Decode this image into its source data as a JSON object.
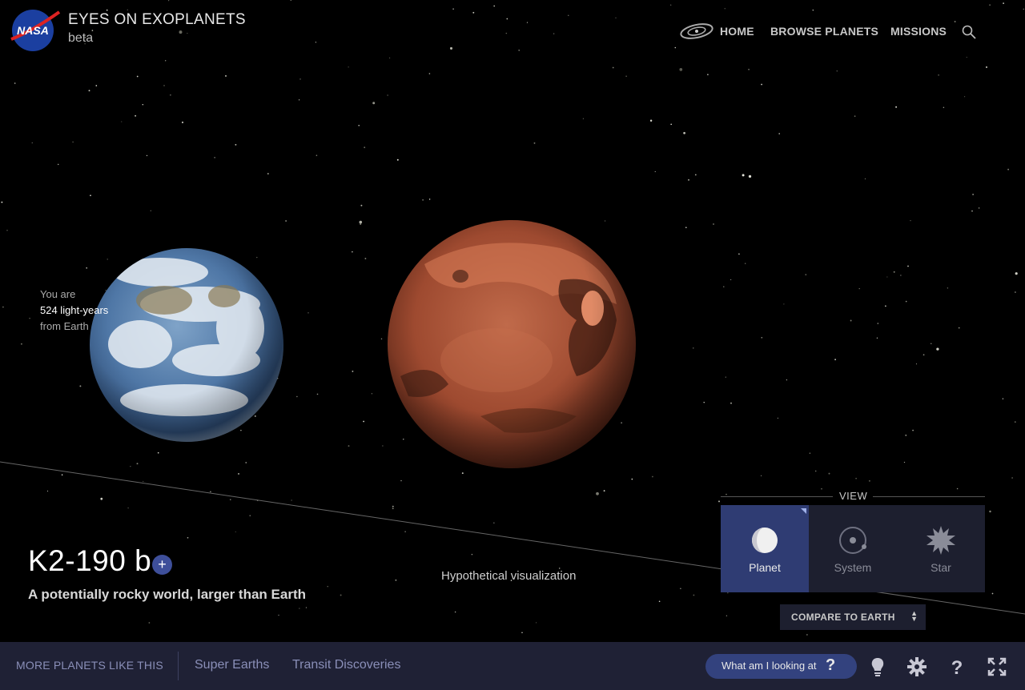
{
  "header": {
    "logo": "nasa-logo",
    "logo_text": "NASA",
    "title": "EYES ON EXOPLANETS",
    "subtitle": "beta",
    "nav": [
      "HOME",
      "BROWSE PLANETS",
      "MISSIONS"
    ],
    "nav_icons": [
      "galaxy-icon",
      "search-icon"
    ]
  },
  "distance": {
    "line1": "You are",
    "value": "524 light-years",
    "line3": "from Earth"
  },
  "planet": {
    "name": "K2-190 b",
    "tagline": "A potentially rocky world, larger than Earth",
    "visualization_note": "Hypothetical visualization"
  },
  "view": {
    "label": "VIEW",
    "options": [
      {
        "label": "Planet",
        "icon": "planet-icon",
        "active": true
      },
      {
        "label": "System",
        "icon": "system-icon",
        "active": false
      },
      {
        "label": "Star",
        "icon": "star-icon",
        "active": false
      }
    ]
  },
  "compare": {
    "label": "COMPARE TO EARTH"
  },
  "bottom_bar": {
    "more_label": "MORE PLANETS LIKE THIS",
    "tags": [
      "Super Earths",
      "Transit Discoveries"
    ],
    "help_button": "What am I looking at",
    "help_glyph": "?",
    "icons": [
      "lightbulb-icon",
      "gear-icon",
      "help-icon",
      "fullscreen-icon"
    ]
  },
  "colors": {
    "background": "#000000",
    "bar": "#1f2135",
    "accent": "#33427e",
    "panel": "#1d1f2f",
    "active_view": "#2f3c73",
    "planet_surface": "#b85c3c"
  }
}
